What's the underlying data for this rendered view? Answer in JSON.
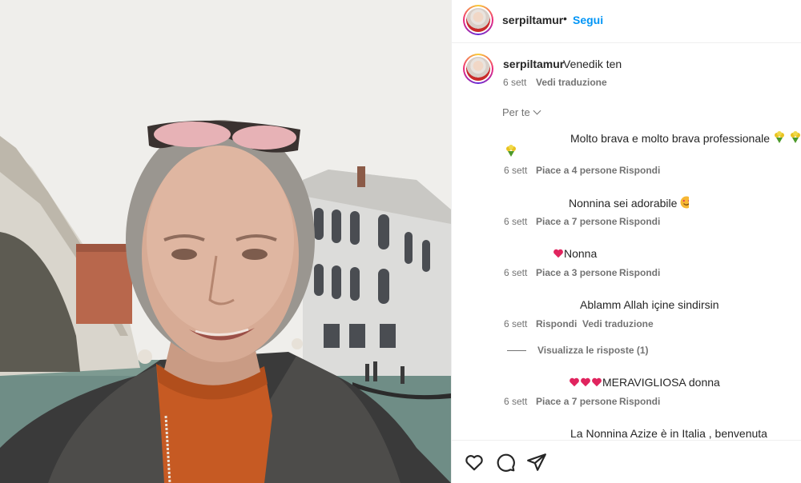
{
  "post": {
    "username": "serpiltamur",
    "follow_label": "Segui",
    "separator": "•"
  },
  "caption": {
    "username": "serpiltamur",
    "text": "Venedik ten",
    "date": "6 sett",
    "translate": "Vedi traduzione"
  },
  "filter_label": "Per te",
  "comments": [
    {
      "text": "Molto brava e molto brava professionale",
      "date": "6 sett",
      "likes": "Piace a 4 persone",
      "reply": "Rispondi"
    },
    {
      "text": "Nonnina sei adorabile",
      "date": "6 sett",
      "likes": "Piace a 7 persone",
      "reply": "Rispondi"
    },
    {
      "text": "Nonna",
      "date": "6 sett",
      "likes": "Piace a 3 persone",
      "reply": "Rispondi"
    },
    {
      "text": "Ablamm Allah içine sindirsin",
      "date": "6 sett",
      "reply": "Rispondi",
      "translate": "Vedi traduzione",
      "view_replies": "Visualizza le risposte (1)"
    },
    {
      "text": "MERAVIGLIOSA donna",
      "date": "6 sett",
      "likes": "Piace a 7 persone",
      "reply": "Rispondi"
    },
    {
      "text": "La Nonnina Azize è in Italia , benvenuta"
    }
  ],
  "icons": {
    "like": "heart-outline-icon",
    "comment": "comment-bubble-icon",
    "share": "paper-plane-icon"
  },
  "colors": {
    "link_blue": "#0095f6",
    "meta_gray": "#737373",
    "text": "#262626",
    "divider": "#efefef"
  }
}
